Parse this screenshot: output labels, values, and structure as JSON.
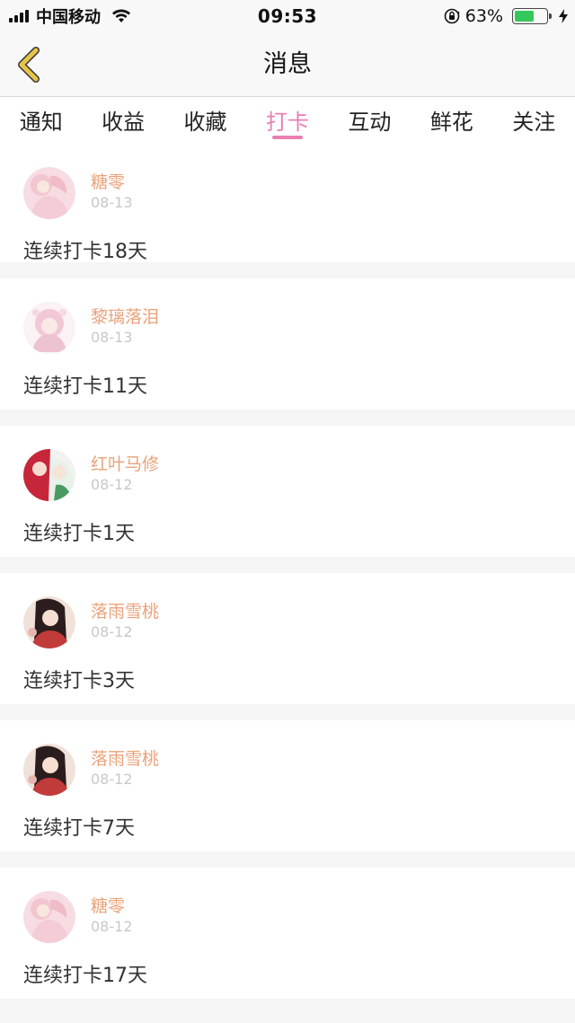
{
  "status_bar": {
    "carrier": "中国移动",
    "time": "09:53",
    "battery_percent": "63%",
    "battery_level": 0.63,
    "battery_color": "#34c759"
  },
  "header": {
    "title": "消息",
    "back_icon": "chevron-left-icon",
    "back_icon_color": "#e6c44a"
  },
  "tabs": [
    {
      "label": "通知",
      "active": false
    },
    {
      "label": "收益",
      "active": false
    },
    {
      "label": "收藏",
      "active": false
    },
    {
      "label": "打卡",
      "active": true
    },
    {
      "label": "互动",
      "active": false
    },
    {
      "label": "鲜花",
      "active": false
    },
    {
      "label": "关注",
      "active": false
    }
  ],
  "accent_color": "#e97fb3",
  "username_color": "#e9a27a",
  "messages": [
    {
      "username": "糖零",
      "date": "08-13",
      "text": "连续打卡18天",
      "avatar": "avatar-pink-girl"
    },
    {
      "username": "黎璃落泪",
      "date": "08-13",
      "text": "连续打卡11天",
      "avatar": "avatar-pink-hair-anime"
    },
    {
      "username": "红叶马修",
      "date": "08-12",
      "text": "连续打卡1天",
      "avatar": "avatar-red-green-anime"
    },
    {
      "username": "落雨雪桃",
      "date": "08-12",
      "text": "连续打卡3天",
      "avatar": "avatar-dark-hair-anime"
    },
    {
      "username": "落雨雪桃",
      "date": "08-12",
      "text": "连续打卡7天",
      "avatar": "avatar-dark-hair-anime"
    },
    {
      "username": "糖零",
      "date": "08-12",
      "text": "连续打卡17天",
      "avatar": "avatar-pink-girl"
    }
  ]
}
